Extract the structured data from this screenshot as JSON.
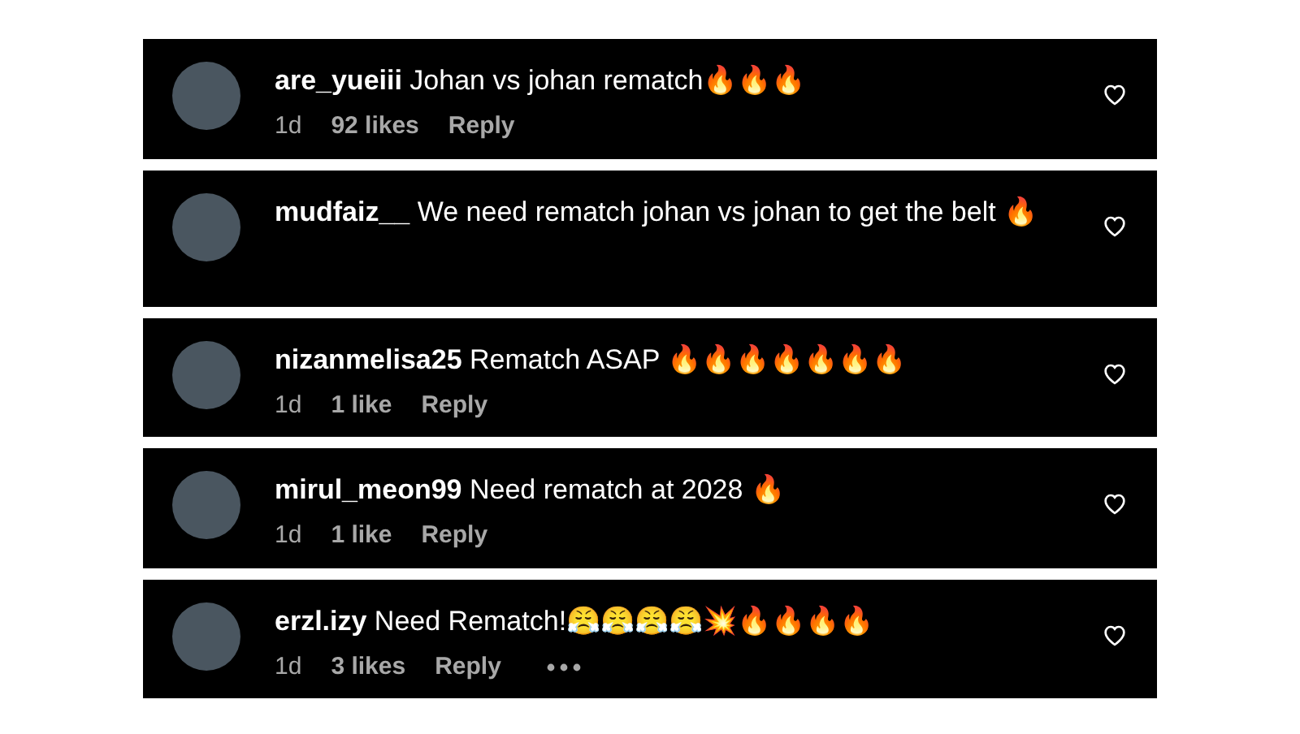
{
  "comments": [
    {
      "username": "are_yueiii",
      "text": "Johan vs johan rematch🔥🔥🔥",
      "meta": {
        "age": "1d",
        "likes": "92 likes",
        "reply": "Reply"
      },
      "more_button": false
    },
    {
      "username": "mudfaiz__",
      "text": "We need rematch johan vs johan to get the belt 🔥",
      "more_button": false
    },
    {
      "username": "nizanmelisa25",
      "text": "Rematch ASAP 🔥🔥🔥🔥🔥🔥🔥",
      "meta": {
        "age": "1d",
        "likes": "1 like",
        "reply": "Reply"
      },
      "more_button": false
    },
    {
      "username": "mirul_meon99",
      "text": "Need rematch at 2028 🔥",
      "meta": {
        "age": "1d",
        "likes": "1 like",
        "reply": "Reply"
      },
      "more_button": false
    },
    {
      "username": "erzl.izy",
      "text": "Need Rematch!😤😤😤😤💥🔥🔥🔥🔥",
      "meta": {
        "age": "1d",
        "likes": "3 likes",
        "reply": "Reply"
      },
      "more_button": true
    }
  ]
}
